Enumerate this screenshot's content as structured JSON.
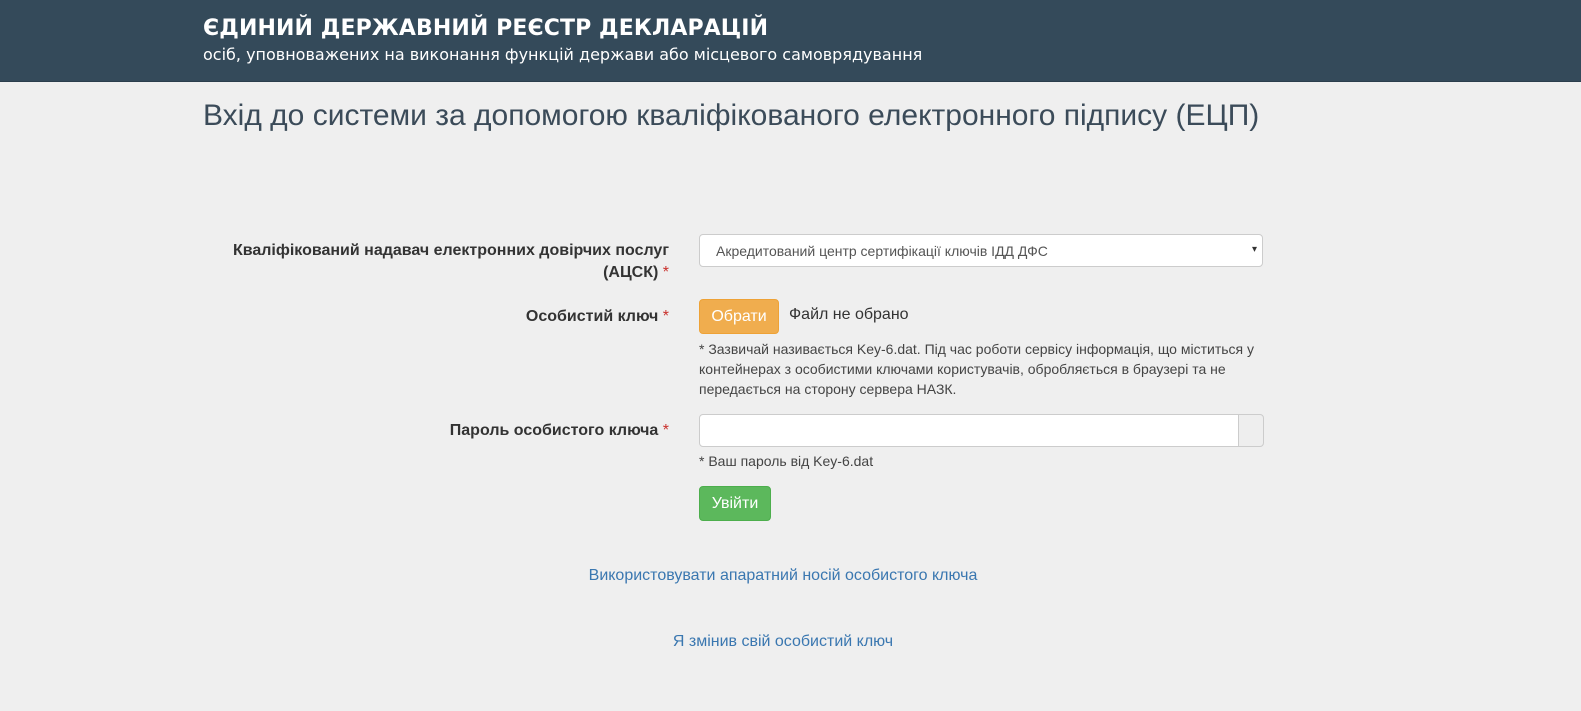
{
  "header": {
    "title": "ЄДИНИЙ ДЕРЖАВНИЙ РЕЄСТР ДЕКЛАРАЦІЙ",
    "subtitle": "осіб, уповноважених на виконання функцій держави або місцевого самоврядування"
  },
  "page": {
    "title": "Вхід до системи за допомогою кваліфікованого електронного підпису (ЕЦП)"
  },
  "form": {
    "provider": {
      "label_line1": "Кваліфікований надавач електронних довірчих послуг",
      "label_line2": "(АЦСК)",
      "required_mark": "*",
      "selected_value": "Акредитований центр сертифікації ключів ІДД ДФС",
      "arrow": "▾"
    },
    "key": {
      "label": "Особистий ключ",
      "required_mark": "*",
      "choose_button": "Обрати",
      "file_status": "Файл не обрано",
      "help_line1": "* Зазвичай називається Key-6.dat. Під час роботи сервісу інформація, що міститься у",
      "help_line2": "контейнерах з особистими ключами користувачів, обробляється в браузері та не",
      "help_line3": "передається на сторону сервера НАЗК."
    },
    "password": {
      "label": "Пароль особистого ключа",
      "required_mark": "*",
      "value": "",
      "help": "* Ваш пароль від Key-6.dat"
    },
    "login_button": "Увійти"
  },
  "links": {
    "hardware": "Використовувати апаратний носій особистого ключа",
    "changed_key": "Я змінив свій особистий ключ"
  },
  "colors": {
    "header_bg": "#344a5a",
    "page_bg": "#efefef",
    "warning_button": "#f0ad4e",
    "success_button": "#5cb85c",
    "link": "#3a77b0",
    "required": "#c9302c"
  }
}
